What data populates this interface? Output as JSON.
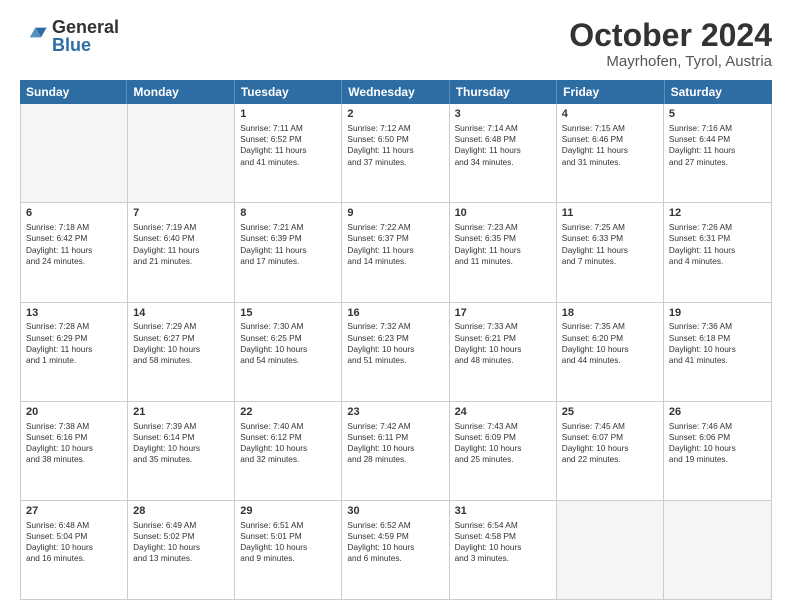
{
  "logo": {
    "line1": "General",
    "line2": "Blue"
  },
  "title": "October 2024",
  "location": "Mayrhofen, Tyrol, Austria",
  "headers": [
    "Sunday",
    "Monday",
    "Tuesday",
    "Wednesday",
    "Thursday",
    "Friday",
    "Saturday"
  ],
  "rows": [
    [
      {
        "day": "",
        "lines": []
      },
      {
        "day": "",
        "lines": []
      },
      {
        "day": "1",
        "lines": [
          "Sunrise: 7:11 AM",
          "Sunset: 6:52 PM",
          "Daylight: 11 hours",
          "and 41 minutes."
        ]
      },
      {
        "day": "2",
        "lines": [
          "Sunrise: 7:12 AM",
          "Sunset: 6:50 PM",
          "Daylight: 11 hours",
          "and 37 minutes."
        ]
      },
      {
        "day": "3",
        "lines": [
          "Sunrise: 7:14 AM",
          "Sunset: 6:48 PM",
          "Daylight: 11 hours",
          "and 34 minutes."
        ]
      },
      {
        "day": "4",
        "lines": [
          "Sunrise: 7:15 AM",
          "Sunset: 6:46 PM",
          "Daylight: 11 hours",
          "and 31 minutes."
        ]
      },
      {
        "day": "5",
        "lines": [
          "Sunrise: 7:16 AM",
          "Sunset: 6:44 PM",
          "Daylight: 11 hours",
          "and 27 minutes."
        ]
      }
    ],
    [
      {
        "day": "6",
        "lines": [
          "Sunrise: 7:18 AM",
          "Sunset: 6:42 PM",
          "Daylight: 11 hours",
          "and 24 minutes."
        ]
      },
      {
        "day": "7",
        "lines": [
          "Sunrise: 7:19 AM",
          "Sunset: 6:40 PM",
          "Daylight: 11 hours",
          "and 21 minutes."
        ]
      },
      {
        "day": "8",
        "lines": [
          "Sunrise: 7:21 AM",
          "Sunset: 6:39 PM",
          "Daylight: 11 hours",
          "and 17 minutes."
        ]
      },
      {
        "day": "9",
        "lines": [
          "Sunrise: 7:22 AM",
          "Sunset: 6:37 PM",
          "Daylight: 11 hours",
          "and 14 minutes."
        ]
      },
      {
        "day": "10",
        "lines": [
          "Sunrise: 7:23 AM",
          "Sunset: 6:35 PM",
          "Daylight: 11 hours",
          "and 11 minutes."
        ]
      },
      {
        "day": "11",
        "lines": [
          "Sunrise: 7:25 AM",
          "Sunset: 6:33 PM",
          "Daylight: 11 hours",
          "and 7 minutes."
        ]
      },
      {
        "day": "12",
        "lines": [
          "Sunrise: 7:26 AM",
          "Sunset: 6:31 PM",
          "Daylight: 11 hours",
          "and 4 minutes."
        ]
      }
    ],
    [
      {
        "day": "13",
        "lines": [
          "Sunrise: 7:28 AM",
          "Sunset: 6:29 PM",
          "Daylight: 11 hours",
          "and 1 minute."
        ]
      },
      {
        "day": "14",
        "lines": [
          "Sunrise: 7:29 AM",
          "Sunset: 6:27 PM",
          "Daylight: 10 hours",
          "and 58 minutes."
        ]
      },
      {
        "day": "15",
        "lines": [
          "Sunrise: 7:30 AM",
          "Sunset: 6:25 PM",
          "Daylight: 10 hours",
          "and 54 minutes."
        ]
      },
      {
        "day": "16",
        "lines": [
          "Sunrise: 7:32 AM",
          "Sunset: 6:23 PM",
          "Daylight: 10 hours",
          "and 51 minutes."
        ]
      },
      {
        "day": "17",
        "lines": [
          "Sunrise: 7:33 AM",
          "Sunset: 6:21 PM",
          "Daylight: 10 hours",
          "and 48 minutes."
        ]
      },
      {
        "day": "18",
        "lines": [
          "Sunrise: 7:35 AM",
          "Sunset: 6:20 PM",
          "Daylight: 10 hours",
          "and 44 minutes."
        ]
      },
      {
        "day": "19",
        "lines": [
          "Sunrise: 7:36 AM",
          "Sunset: 6:18 PM",
          "Daylight: 10 hours",
          "and 41 minutes."
        ]
      }
    ],
    [
      {
        "day": "20",
        "lines": [
          "Sunrise: 7:38 AM",
          "Sunset: 6:16 PM",
          "Daylight: 10 hours",
          "and 38 minutes."
        ]
      },
      {
        "day": "21",
        "lines": [
          "Sunrise: 7:39 AM",
          "Sunset: 6:14 PM",
          "Daylight: 10 hours",
          "and 35 minutes."
        ]
      },
      {
        "day": "22",
        "lines": [
          "Sunrise: 7:40 AM",
          "Sunset: 6:12 PM",
          "Daylight: 10 hours",
          "and 32 minutes."
        ]
      },
      {
        "day": "23",
        "lines": [
          "Sunrise: 7:42 AM",
          "Sunset: 6:11 PM",
          "Daylight: 10 hours",
          "and 28 minutes."
        ]
      },
      {
        "day": "24",
        "lines": [
          "Sunrise: 7:43 AM",
          "Sunset: 6:09 PM",
          "Daylight: 10 hours",
          "and 25 minutes."
        ]
      },
      {
        "day": "25",
        "lines": [
          "Sunrise: 7:45 AM",
          "Sunset: 6:07 PM",
          "Daylight: 10 hours",
          "and 22 minutes."
        ]
      },
      {
        "day": "26",
        "lines": [
          "Sunrise: 7:46 AM",
          "Sunset: 6:06 PM",
          "Daylight: 10 hours",
          "and 19 minutes."
        ]
      }
    ],
    [
      {
        "day": "27",
        "lines": [
          "Sunrise: 6:48 AM",
          "Sunset: 5:04 PM",
          "Daylight: 10 hours",
          "and 16 minutes."
        ]
      },
      {
        "day": "28",
        "lines": [
          "Sunrise: 6:49 AM",
          "Sunset: 5:02 PM",
          "Daylight: 10 hours",
          "and 13 minutes."
        ]
      },
      {
        "day": "29",
        "lines": [
          "Sunrise: 6:51 AM",
          "Sunset: 5:01 PM",
          "Daylight: 10 hours",
          "and 9 minutes."
        ]
      },
      {
        "day": "30",
        "lines": [
          "Sunrise: 6:52 AM",
          "Sunset: 4:59 PM",
          "Daylight: 10 hours",
          "and 6 minutes."
        ]
      },
      {
        "day": "31",
        "lines": [
          "Sunrise: 6:54 AM",
          "Sunset: 4:58 PM",
          "Daylight: 10 hours",
          "and 3 minutes."
        ]
      },
      {
        "day": "",
        "lines": []
      },
      {
        "day": "",
        "lines": []
      }
    ]
  ]
}
